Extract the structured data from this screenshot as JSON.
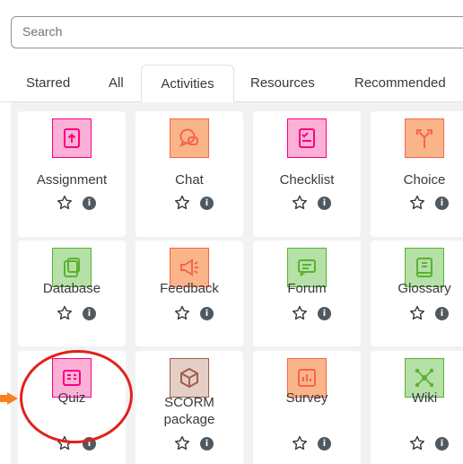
{
  "search": {
    "placeholder": "Search"
  },
  "tabs": [
    {
      "label": "Starred"
    },
    {
      "label": "All"
    },
    {
      "label": "Activities"
    },
    {
      "label": "Resources"
    },
    {
      "label": "Recommended"
    }
  ],
  "activities": [
    {
      "name": "Assignment",
      "icon": "assignment-icon",
      "color": "#f90086",
      "bg": "#fbb1d5"
    },
    {
      "name": "Chat",
      "icon": "chat-icon",
      "color": "#f7634d",
      "bg": "#f9b589"
    },
    {
      "name": "Checklist",
      "icon": "checklist-icon",
      "color": "#f90086",
      "bg": "#fbb1d5"
    },
    {
      "name": "Choice",
      "icon": "choice-icon",
      "color": "#f7634d",
      "bg": "#f9b589"
    },
    {
      "name": "Database",
      "icon": "database-icon",
      "color": "#5bb12f",
      "bg": "#b5e0a8"
    },
    {
      "name": "Feedback",
      "icon": "feedback-icon",
      "color": "#f7634d",
      "bg": "#f9b589"
    },
    {
      "name": "Forum",
      "icon": "forum-icon",
      "color": "#5bb12f",
      "bg": "#b5e0a8"
    },
    {
      "name": "Glossary",
      "icon": "glossary-icon",
      "color": "#5bb12f",
      "bg": "#b5e0a8"
    },
    {
      "name": "Quiz",
      "icon": "quiz-icon",
      "color": "#f90086",
      "bg": "#fbb1d5"
    },
    {
      "name": "SCORM package",
      "icon": "scorm-package-icon",
      "color": "#a35c4c",
      "bg": "#e4cfc7"
    },
    {
      "name": "Survey",
      "icon": "survey-icon",
      "color": "#f7634d",
      "bg": "#f9b589"
    },
    {
      "name": "Wiki",
      "icon": "wiki-icon",
      "color": "#5bb12f",
      "bg": "#b5e0a8"
    }
  ],
  "colors": {
    "annotation": "#e32119",
    "annotation_arrow": "#f7821b",
    "info_badge": "#505860"
  }
}
